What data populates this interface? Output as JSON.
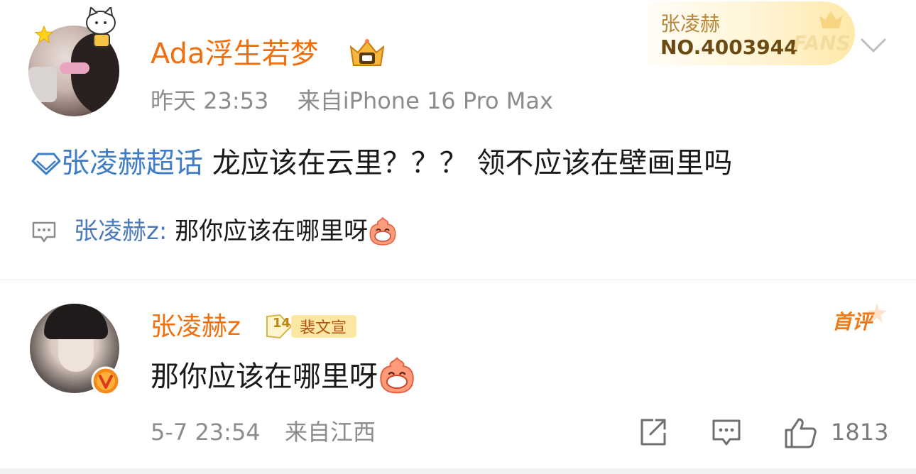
{
  "post": {
    "username": "Ada浮生若梦",
    "timestamp": "昨天 23:53",
    "source": "来自iPhone 16 Pro Max",
    "fans_card": {
      "name": "张凌赫",
      "number": "NO.4003944",
      "label": "FANS"
    },
    "topic": "张凌赫超话",
    "text": " 龙应该在云里？？？ 领不应该在壁画里吗",
    "quote": {
      "user": "张凌赫z:",
      "text": " 那你应该在哪里呀"
    }
  },
  "comment": {
    "username": "张凌赫z",
    "level_number": "14",
    "level_title": "裴文宣",
    "first_comment_tag": "首评",
    "text": "那你应该在哪里呀",
    "date": "5-7 23:54",
    "location": "来自江西",
    "like_count": "1813"
  },
  "colors": {
    "username_orange": "#f0700e",
    "topic_blue": "#3f7ec7",
    "meta_gray": "#8c8c8c"
  },
  "icons": [
    "star-icon",
    "crown-icon",
    "chevron-down-icon",
    "diamond-topic-icon",
    "comment-quote-icon",
    "laughing-emoji-icon",
    "verified-v-icon",
    "share-icon",
    "reply-icon",
    "like-icon"
  ]
}
